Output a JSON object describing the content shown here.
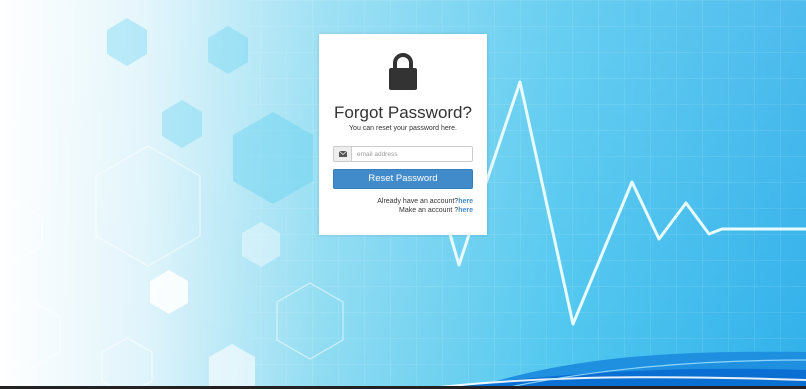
{
  "background": {
    "primary_color": "#36b8ee",
    "light_color": "#ffffff"
  },
  "card": {
    "icon": "lock-icon",
    "title": "Forgot Password?",
    "subtitle": "You can reset your password here.",
    "email": {
      "icon": "envelope-icon",
      "value": "",
      "placeholder": "email address"
    },
    "reset_button_label": "Reset Password",
    "login_prompt": "Already have an account?",
    "login_link": "here",
    "signup_prompt": "Make an account ?",
    "signup_link": "here"
  },
  "colors": {
    "button": "#428bca",
    "link": "#428bca",
    "text": "#333333"
  }
}
